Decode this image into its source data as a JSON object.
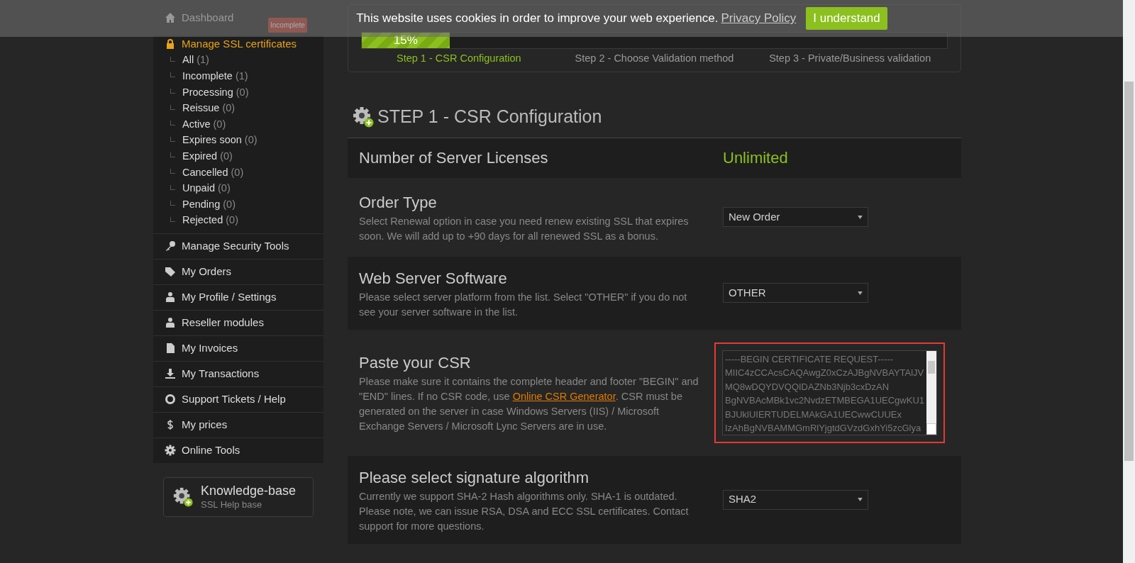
{
  "cookie_banner": {
    "message": "This website uses cookies in order to improve your web experience.",
    "link": "Privacy Policy",
    "button": "I understand"
  },
  "sidebar": {
    "dashboard": "Dashboard",
    "badge": "Incomplete",
    "ssl_section": {
      "label": "Manage SSL certificates",
      "selected": true,
      "children": [
        {
          "label": "All",
          "count": "(1)"
        },
        {
          "label": "Incomplete",
          "count": "(1)"
        },
        {
          "label": "Processing",
          "count": "(0)"
        },
        {
          "label": "Reissue",
          "count": "(0)"
        },
        {
          "label": "Active",
          "count": "(0)"
        },
        {
          "label": "Expires soon",
          "count": "(0)"
        },
        {
          "label": "Expired",
          "count": "(0)"
        },
        {
          "label": "Cancelled",
          "count": "(0)"
        },
        {
          "label": "Unpaid",
          "count": "(0)"
        },
        {
          "label": "Pending",
          "count": "(0)"
        },
        {
          "label": "Rejected",
          "count": "(0)"
        }
      ]
    },
    "items": [
      {
        "label": "Manage Security Tools",
        "kind": "key"
      },
      {
        "label": "My Orders",
        "kind": "tag"
      },
      {
        "label": "My Profile / Settings",
        "kind": "user"
      },
      {
        "label": "Reseller modules",
        "kind": "user"
      },
      {
        "label": "My Invoices",
        "kind": "file"
      },
      {
        "label": "My Transactions",
        "kind": "download"
      },
      {
        "label": "Support Tickets / Help",
        "kind": "ring"
      },
      {
        "label": "My prices",
        "kind": "dollar"
      },
      {
        "label": "Online Tools",
        "kind": "gear"
      }
    ],
    "knowledge_base": {
      "title": "Knowledge-base",
      "subtitle": "SSL Help base"
    }
  },
  "progress": {
    "label": "15%",
    "level": 0.15,
    "steps": [
      {
        "label": "Step 1 - CSR Configuration",
        "selected": true
      },
      {
        "label": "Step 2 - Choose Validation method",
        "selected": false
      },
      {
        "label": "Step 3 - Private/Business validation",
        "selected": false
      }
    ]
  },
  "section_title": "STEP 1 - CSR Configuration",
  "rows": [
    {
      "kind": "value",
      "title": "Number of Server Licenses",
      "value": "Unlimited"
    },
    {
      "kind": "select",
      "title": "Order Type",
      "description": "Select Renewal option in case you need renew existing SSL that expires soon. We will add up to +90 days for all renewed SSL as a bonus.",
      "value": "New Order"
    },
    {
      "kind": "select",
      "title": "Web Server Software",
      "description": "Please select server platform from the list. Select \"OTHER\" if you do not see your server software in the list.",
      "value": "OTHER"
    },
    {
      "kind": "textarea",
      "title": "Paste your CSR",
      "description_before": "Please make sure it contains the complete header and footer \"BEGIN\" and \"END\" lines. If no CSR code, use",
      "link": "Online CSR Generator",
      "description_after": ". CSR must be generated on the server in case Windows Servers (IIS) / Microsoft Exchange Servers / Microsoft Lync Servers are in use.",
      "lines": [
        "-----BEGIN CERTIFICATE REQUEST-----",
        "MIIC4zCCAcsCAQAwgZ0xCzAJBgNVBAYTAlJV",
        "MQ8wDQYDVQQIDAZNb3Njb3cxDzAN",
        "BgNVBAcMBk1vc2NvdzETMBEGA1UECgwKU1",
        "BJUklUIERTUDELMAkGA1UECwwCUUEx",
        "IzAhBgNVBAMMGmRlYjgtdGVzdGxhYi5zcGlya"
      ],
      "highlighted": true
    },
    {
      "kind": "select",
      "title": "Please select signature algorithm",
      "description": "Currently we support SHA-2 Hash algorithms only. SHA-1 is outdated. Please note, we can issue RSA, DSA and ECC SSL certificates. Contact support for more questions.",
      "value": "SHA2"
    }
  ]
}
